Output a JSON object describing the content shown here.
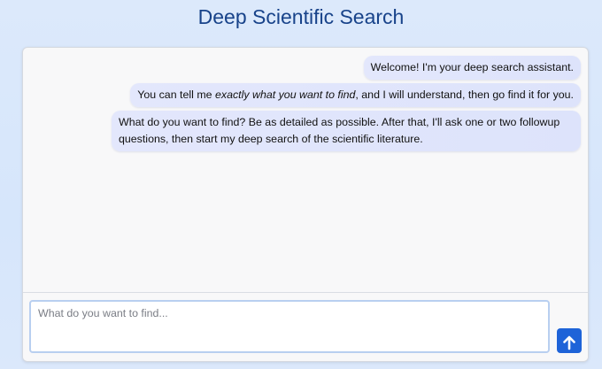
{
  "header": {
    "title": "Deep Scientific Search"
  },
  "chat": {
    "messages": [
      {
        "text": "Welcome! I'm your deep search assistant."
      },
      {
        "prefix": "You can tell me ",
        "emphasis": "exactly what you want to find",
        "suffix": ", and I will understand, then go find it for you."
      },
      {
        "text": "What do you want to find? Be as detailed as possible. After that, I'll ask one or two followup questions, then start my deep search of the scientific literature."
      }
    ]
  },
  "composer": {
    "placeholder": "What do you want to find...",
    "value": "",
    "send_icon": "arrow-up-icon",
    "accent_color": "#1e63d8"
  }
}
